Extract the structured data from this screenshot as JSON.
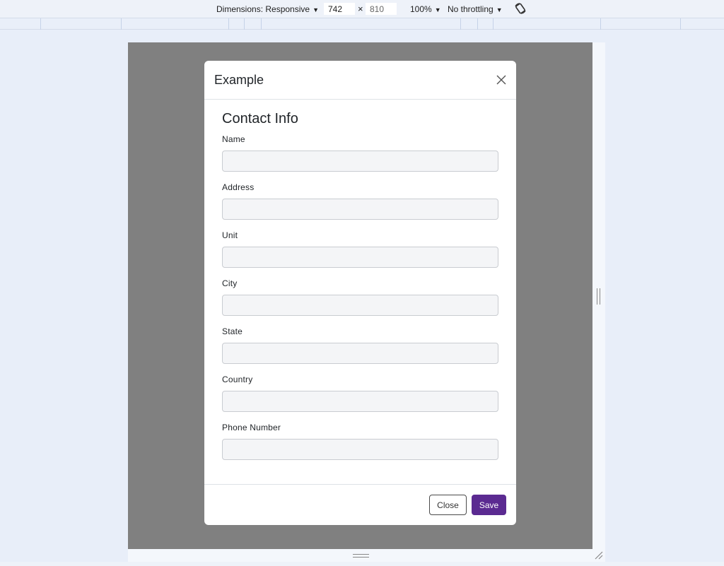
{
  "devtools": {
    "dimensions_label": "Dimensions: Responsive",
    "width_value": "742",
    "times": "×",
    "height_value": "810",
    "zoom_label": "100%",
    "throttle_label": "No throttling"
  },
  "modal": {
    "title": "Example",
    "section_title": "Contact Info",
    "fields": [
      {
        "label": "Name",
        "value": ""
      },
      {
        "label": "Address",
        "value": ""
      },
      {
        "label": "Unit",
        "value": ""
      },
      {
        "label": "City",
        "value": ""
      },
      {
        "label": "State",
        "value": ""
      },
      {
        "label": "Country",
        "value": ""
      },
      {
        "label": "Phone Number",
        "value": ""
      }
    ],
    "close_label": "Close",
    "save_label": "Save"
  },
  "colors": {
    "primary": "#5b2a91",
    "backdrop": "#808080",
    "input_bg": "#f4f5f7"
  }
}
